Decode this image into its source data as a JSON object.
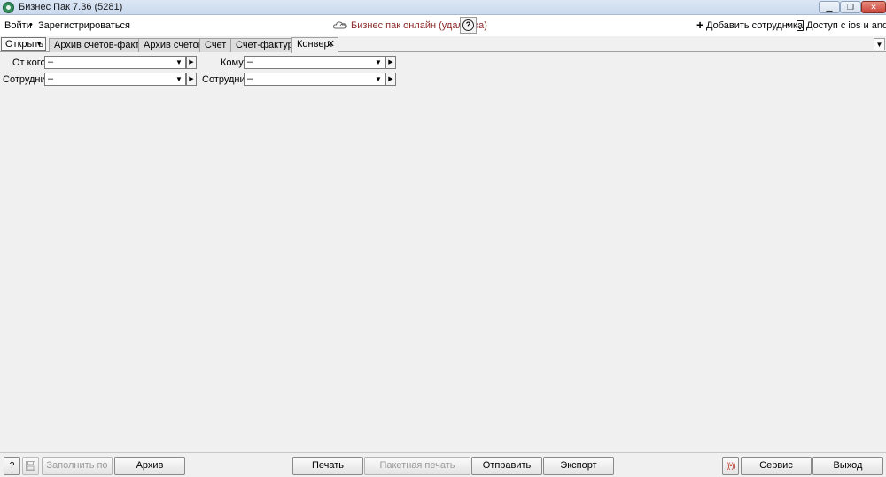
{
  "window": {
    "title": "Бизнес Пак 7.36 (5281)",
    "minimize": "▁",
    "restore": "❐",
    "close": "✕"
  },
  "topbar": {
    "login": "Войти",
    "separator": "•",
    "register": "Зарегистрироваться",
    "online": "Бизнес пак онлайн (удалёнка)",
    "help": "?",
    "add_employee_icon": "+",
    "add_employee": "Добавить сотрудника",
    "mobile_access": "Доступ с ios и android"
  },
  "tabs": {
    "open_label": "Открыть",
    "open_caret": "▼",
    "items": [
      {
        "label": "Архив счетов-фактур"
      },
      {
        "label": "Архив счетов"
      },
      {
        "label": "Счет"
      },
      {
        "label": "Счет-фактура"
      },
      {
        "label": "Конверт",
        "close": "✕"
      }
    ],
    "overflow": "▼"
  },
  "form": {
    "from_label": "От кого",
    "from_value": "–",
    "to_label": "Кому",
    "to_value": "–",
    "employee_left_label": "Сотрудник",
    "employee_left_value": "–",
    "employee_right_label": "Сотрудник",
    "employee_right_value": "–",
    "combo_arrow": "▼",
    "go_arrow": "▶"
  },
  "bottombar": {
    "help": "?",
    "save_icon": "💾",
    "fill_by": "Заполнить по",
    "archive": "Архив",
    "print": "Печать",
    "batch_print": "Пакетная печать",
    "send": "Отправить",
    "export": "Экспорт",
    "broadcast_icon": "((•))",
    "service": "Сервис",
    "exit": "Выход"
  }
}
